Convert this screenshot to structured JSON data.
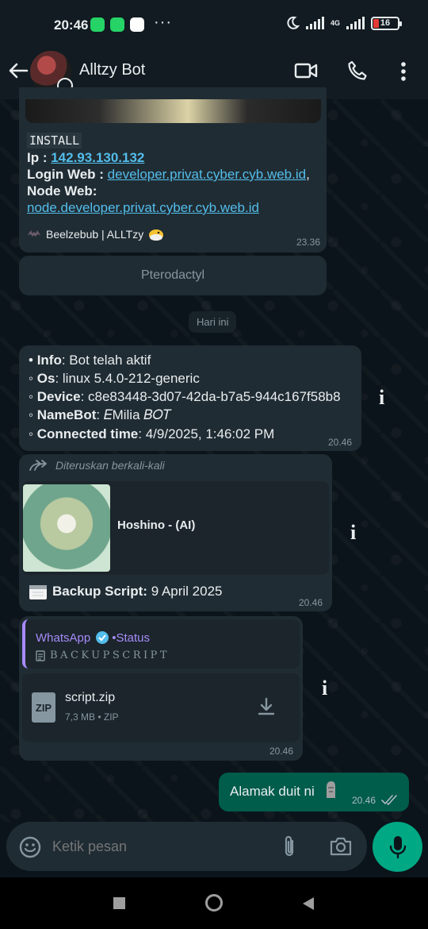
{
  "status_bar": {
    "time": "20:46",
    "dots": "···",
    "network": "4G",
    "battery": "16",
    "colors": {
      "whatsapp": "#25d366",
      "google": "#ffffff",
      "battery_low": "#e53935"
    },
    "icons": [
      "whatsapp-icon",
      "whatsapp-business-icon",
      "google-icon",
      "moon-icon",
      "signal-icon",
      "battery-icon"
    ]
  },
  "header": {
    "title": "Alltzy Bot",
    "icons": [
      "back-arrow-icon",
      "video-call-icon",
      "phone-icon",
      "more-vertical-icon"
    ]
  },
  "messages": {
    "install": {
      "label": "INSTALL",
      "ip_label": "Ip : ",
      "ip_value": "142.93.130.132",
      "login_label": "Login Web : ",
      "login_value": "developer.privat.cyber.cyb.web.id",
      "login_suffix": ",",
      "node_label": "Node Web:",
      "node_value": "node.developer.privat.cyber.cyb.web.id",
      "footer": "Beelzebub | ALLTzy",
      "time": "23.36"
    },
    "button_pterodactyl": "Pterodactyl",
    "date_divider": "Hari ini",
    "info": {
      "line1_prefix": "• ",
      "line1_key": "Info",
      "line1_val": ": Bot telah aktif",
      "line2_prefix": "◦ ",
      "line2_key": "Os",
      "line2_val": ": linux 5.4.0-212-generic",
      "line3_prefix": "◦ ",
      "line3_key": "Device",
      "line3_val": ": c8e83448-3d07-42da-b7a5-944c167f58b8",
      "line4_prefix": "◦ ",
      "line4_key": "NameBot",
      "line4_val": ": 𝐸Milia  𝐵𝑂𝑇",
      "line5_prefix": "◦ ",
      "line5_key": "Connected time",
      "line5_val": ": 4/9/2025, 1:46:02 PM",
      "time": "20.46"
    },
    "forwarded": {
      "label": "Diteruskan berkali-kali",
      "card_title": "Hoshino - (AI)",
      "backup_key": "Backup Script:",
      "backup_val": " 9 April 2025",
      "time": "20.46"
    },
    "file": {
      "quote_source": "WhatsApp",
      "quote_dot": " • ",
      "quote_status": "Status",
      "quote_text": "BACKUPSCRIPT",
      "filename": "script.zip",
      "meta": "7,3 MB • ZIP",
      "badge": "ZIP",
      "time": "20.46"
    },
    "outgoing": {
      "text": "Alamak duit ni",
      "time": "20.46"
    }
  },
  "composer": {
    "placeholder": "Ketik pesan",
    "icons": [
      "emoji-icon",
      "attach-icon",
      "camera-icon",
      "mic-icon"
    ]
  },
  "side_info_icon": "i"
}
